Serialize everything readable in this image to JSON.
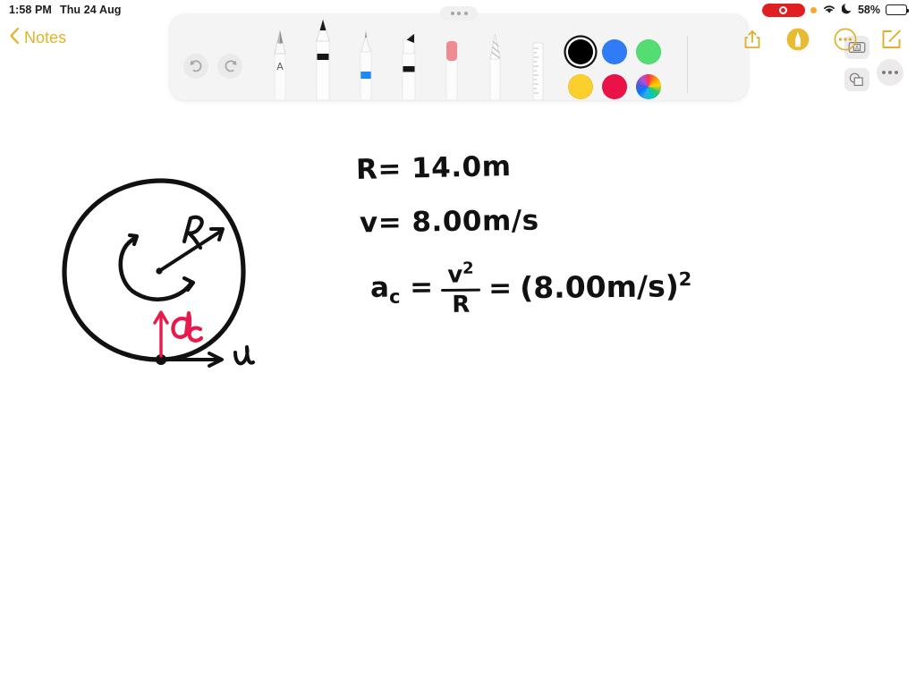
{
  "status_bar": {
    "time": "1:58 PM",
    "date": "Thu 24 Aug",
    "battery_percent": "58%",
    "recording_indicator": "screen-recording",
    "privacy_dot": "orange",
    "wifi": "wifi-icon",
    "focus": "do-not-disturb-moon"
  },
  "navigation": {
    "back_label": "Notes"
  },
  "toolbar": {
    "handle": "drag-handle",
    "undo_label": "Undo",
    "redo_label": "Redo",
    "undo_enabled": "false",
    "redo_enabled": "false",
    "tools": [
      {
        "id": "pen-handwriting",
        "label": "Handwriting Pen",
        "badge": "A",
        "selected": "false"
      },
      {
        "id": "pen-black",
        "label": "Pen",
        "selected": "true"
      },
      {
        "id": "pen-fountain",
        "label": "Fountain Pen",
        "accent": "#1c8cf0",
        "selected": "false"
      },
      {
        "id": "marker",
        "label": "Marker",
        "selected": "false"
      },
      {
        "id": "eraser",
        "label": "Eraser",
        "accent": "#ef8b92",
        "selected": "false"
      },
      {
        "id": "lasso",
        "label": "Lasso Select",
        "selected": "false"
      },
      {
        "id": "ruler",
        "label": "Ruler",
        "selected": "false"
      }
    ],
    "colors": [
      {
        "name": "black",
        "hex": "#000000",
        "selected": "true"
      },
      {
        "name": "blue",
        "hex": "#2f7cf6",
        "selected": "false"
      },
      {
        "name": "green",
        "hex": "#54dd72",
        "selected": "false"
      },
      {
        "name": "yellow",
        "hex": "#fbd02c",
        "selected": "false"
      },
      {
        "name": "red",
        "hex": "#ea1246",
        "selected": "false"
      },
      {
        "name": "rainbow",
        "hex": "rainbow",
        "selected": "false"
      }
    ],
    "utilities": [
      {
        "id": "text-box",
        "label": "Add Text Box"
      },
      {
        "id": "shapes",
        "label": "Shapes"
      }
    ],
    "more_label": "More Options"
  },
  "top_actions": [
    {
      "id": "share",
      "label": "Share"
    },
    {
      "id": "markup",
      "label": "Markup",
      "active": "true"
    },
    {
      "id": "more",
      "label": "More"
    },
    {
      "id": "compose",
      "label": "New Note"
    }
  ],
  "note": {
    "handwriting": [
      {
        "id": "given-radius",
        "text": "R= 14.0m"
      },
      {
        "id": "given-velocity",
        "text": "v= 8.00m/s"
      },
      {
        "id": "equation-ac",
        "text": "ac = v²/R = (8.00m/s)²"
      }
    ],
    "diagram": {
      "title": "circular-motion-diagram",
      "labels": {
        "radius": "R",
        "acceleration": "ac",
        "velocity": "v"
      },
      "ink_colors": {
        "black": "#111111",
        "red": "#e8194b"
      }
    }
  }
}
